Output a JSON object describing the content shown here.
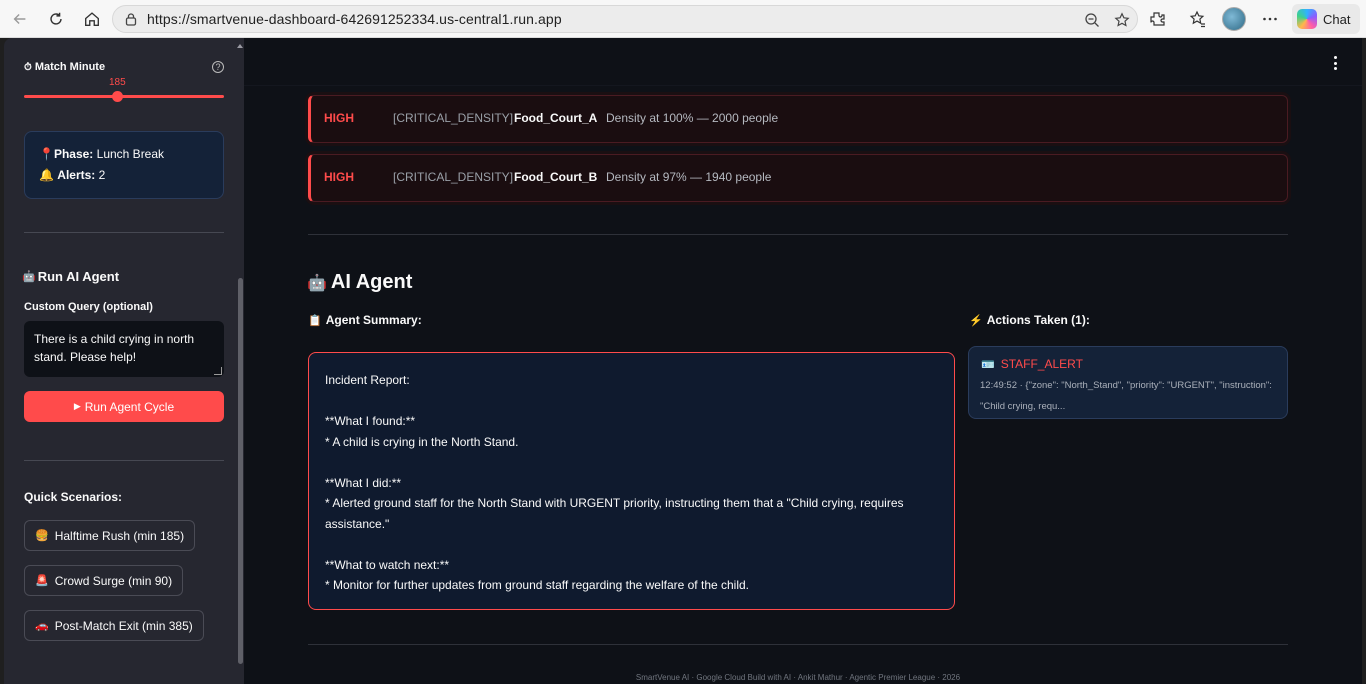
{
  "browser": {
    "url": "https://smartvenue-dashboard-642691252334.us-central1.run.app",
    "copilot_label": "Chat"
  },
  "sidebar": {
    "slider": {
      "label": "Match Minute",
      "value": "185",
      "min": 0,
      "max": 400,
      "current": 185
    },
    "status": {
      "phase_label": "Phase:",
      "phase_value": "Lunch Break",
      "alerts_label": "Alerts:",
      "alerts_value": "2"
    },
    "agent": {
      "heading": "Run AI Agent",
      "query_label": "Custom Query (optional)",
      "query_value": "There is a child crying in north stand. Please help!",
      "run_button": "Run Agent Cycle"
    },
    "scenarios": {
      "heading": "Quick Scenarios:",
      "items": [
        {
          "label": "Halftime Rush (min 185)"
        },
        {
          "label": "Crowd Surge (min 90)"
        },
        {
          "label": "Post-Match Exit (min 385)"
        }
      ]
    }
  },
  "alerts": [
    {
      "severity": "HIGH",
      "type": "[CRITICAL_DENSITY]",
      "zone": "Food_Court_A",
      "description": "Density at 100% — 2000 people"
    },
    {
      "severity": "HIGH",
      "type": "[CRITICAL_DENSITY]",
      "zone": "Food_Court_B",
      "description": "Density at 97% — 1940 people"
    }
  ],
  "ai_agent": {
    "title": "AI Agent",
    "summary_label": "Agent Summary:",
    "summary_lines": [
      "Incident Report:",
      "",
      "**What I found:**",
      "* A child is crying in the North Stand.",
      "",
      "**What I did:**",
      "* Alerted ground staff for the North Stand with URGENT priority, instructing them that a \"Child crying, requires assistance.\"",
      "",
      "**What to watch next:**",
      "* Monitor for further updates from ground staff regarding the welfare of the child."
    ],
    "actions_label": "Actions Taken (1):",
    "actions": [
      {
        "name": "STAFF_ALERT",
        "detail": "12:49:52 · {\"zone\": \"North_Stand\", \"priority\": \"URGENT\", \"instruction\": \"Child crying, requ..."
      }
    ]
  },
  "footer": "SmartVenue AI · Google Cloud Build with AI · Ankit Mathur · Agentic Premier League · 2026",
  "colors": {
    "accent": "#ff4b4b",
    "background": "#0e1117",
    "sidebar": "#262730",
    "card": "#142238"
  }
}
